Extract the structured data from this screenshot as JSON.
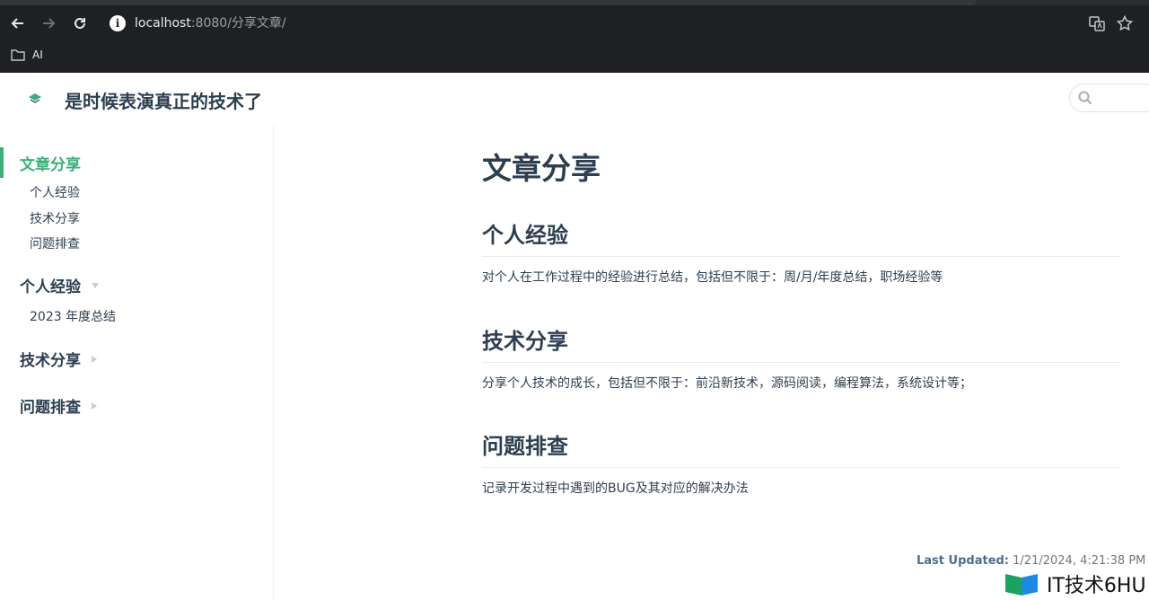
{
  "browser": {
    "url_host": "localhost",
    "url_rest": ":8080/分享文章/",
    "bookmark_label": "AI"
  },
  "site": {
    "title": "是时候表演真正的技术了",
    "search_placeholder": ""
  },
  "sidebar": {
    "groups": [
      {
        "title": "文章分享",
        "active": true,
        "items": [
          "个人经验",
          "技术分享",
          "问题排查"
        ]
      },
      {
        "title": "个人经验",
        "expanded": true,
        "items": [
          "2023 年度总结"
        ]
      },
      {
        "title": "技术分享",
        "expanded": false,
        "items": []
      },
      {
        "title": "问题排查",
        "expanded": false,
        "items": []
      }
    ]
  },
  "content": {
    "title": "文章分享",
    "sections": [
      {
        "heading": "个人经验",
        "text": "对个人在工作过程中的经验进行总结，包括但不限于：周/月/年度总结，职场经验等"
      },
      {
        "heading": "技术分享",
        "text": "分享个人技术的成长，包括但不限于：前沿新技术，源码阅读，编程算法，系统设计等；"
      },
      {
        "heading": "问题排查",
        "text": "记录开发过程中遇到的BUG及其对应的解决办法"
      }
    ],
    "last_updated_label": "Last Updated:",
    "last_updated_value": "1/21/2024, 4:21:38 PM"
  },
  "watermark": {
    "text": "IT技术6HU"
  },
  "colors": {
    "accent": "#3eaf7c",
    "text": "#2c3e50",
    "chrome_bg": "#1f2023"
  }
}
